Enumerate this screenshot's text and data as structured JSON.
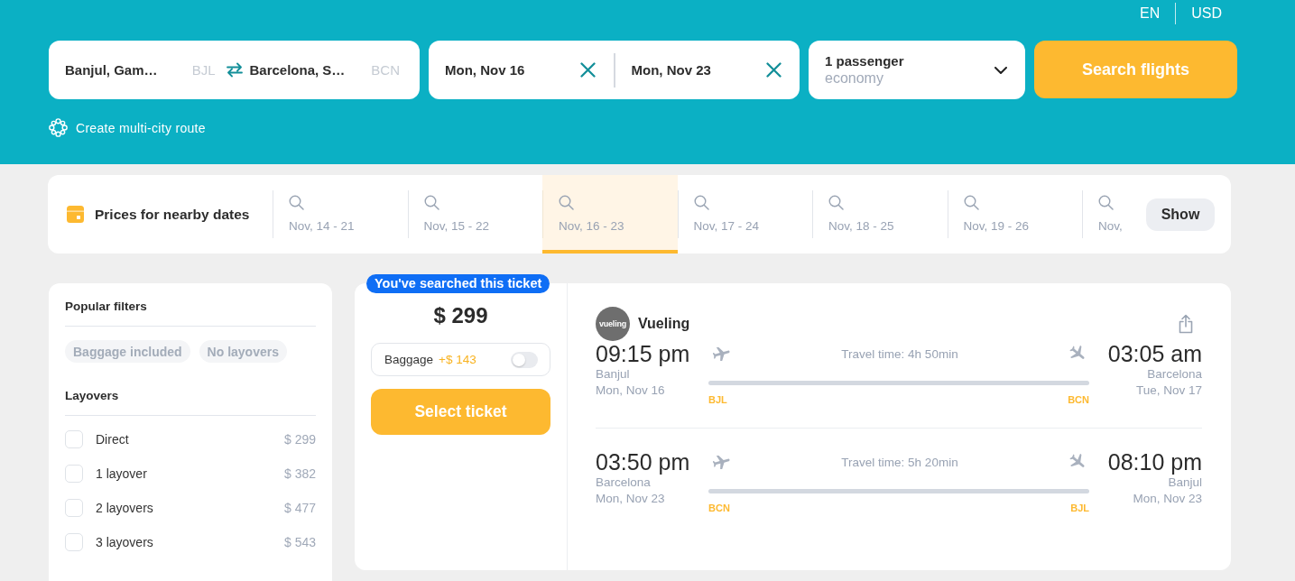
{
  "header": {
    "language": "EN",
    "currency": "USD"
  },
  "search": {
    "origin": {
      "city": "Banjul, Gam…",
      "code": "BJL"
    },
    "destination": {
      "city": "Barcelona, S…",
      "code": "BCN"
    },
    "depart_date": "Mon, Nov 16",
    "return_date": "Mon, Nov 23",
    "passengers": "1 passenger",
    "cabin_class": "economy",
    "search_button": "Search flights"
  },
  "multi_city_link": "Create multi-city route",
  "nearby_dates": {
    "title": "Prices for nearby dates",
    "dates": [
      {
        "label": "Nov, 14 - 21",
        "selected": false
      },
      {
        "label": "Nov, 15 - 22",
        "selected": false
      },
      {
        "label": "Nov, 16 - 23",
        "selected": true
      },
      {
        "label": "Nov, 17 - 24",
        "selected": false
      },
      {
        "label": "Nov, 18 - 25",
        "selected": false
      },
      {
        "label": "Nov, 19 - 26",
        "selected": false
      },
      {
        "label": "Nov,",
        "selected": false
      }
    ],
    "show_button": "Show"
  },
  "filters": {
    "popular": {
      "title": "Popular filters",
      "chips": [
        "Baggage included",
        "No layovers"
      ]
    },
    "layovers": {
      "title": "Layovers",
      "options": [
        {
          "label": "Direct",
          "price": "$ 299",
          "checked": false
        },
        {
          "label": "1 layover",
          "price": "$ 382",
          "checked": false
        },
        {
          "label": "2 layovers",
          "price": "$ 477",
          "checked": false
        },
        {
          "label": "3 layovers",
          "price": "$ 543",
          "checked": false
        }
      ]
    }
  },
  "ticket": {
    "badge": "You've searched this ticket",
    "price": "$ 299",
    "baggage": {
      "label": "Baggage",
      "extra": "+$ 143",
      "on": false
    },
    "select_button": "Select ticket",
    "airline": {
      "logo_text": "vueling",
      "name": "Vueling"
    },
    "segments": [
      {
        "depart_time": "09:15 pm",
        "depart_city": "Banjul",
        "depart_date": "Mon, Nov 16",
        "travel_time": "Travel time: 4h 50min",
        "from_code": "BJL",
        "to_code": "BCN",
        "arrive_time": "03:05 am",
        "arrive_city": "Barcelona",
        "arrive_date": "Tue, Nov 17"
      },
      {
        "depart_time": "03:50 pm",
        "depart_city": "Barcelona",
        "depart_date": "Mon, Nov 23",
        "travel_time": "Travel time: 5h 20min",
        "from_code": "BCN",
        "to_code": "BJL",
        "arrive_time": "08:10 pm",
        "arrive_city": "Banjul",
        "arrive_date": "Mon, Nov 23"
      }
    ]
  }
}
